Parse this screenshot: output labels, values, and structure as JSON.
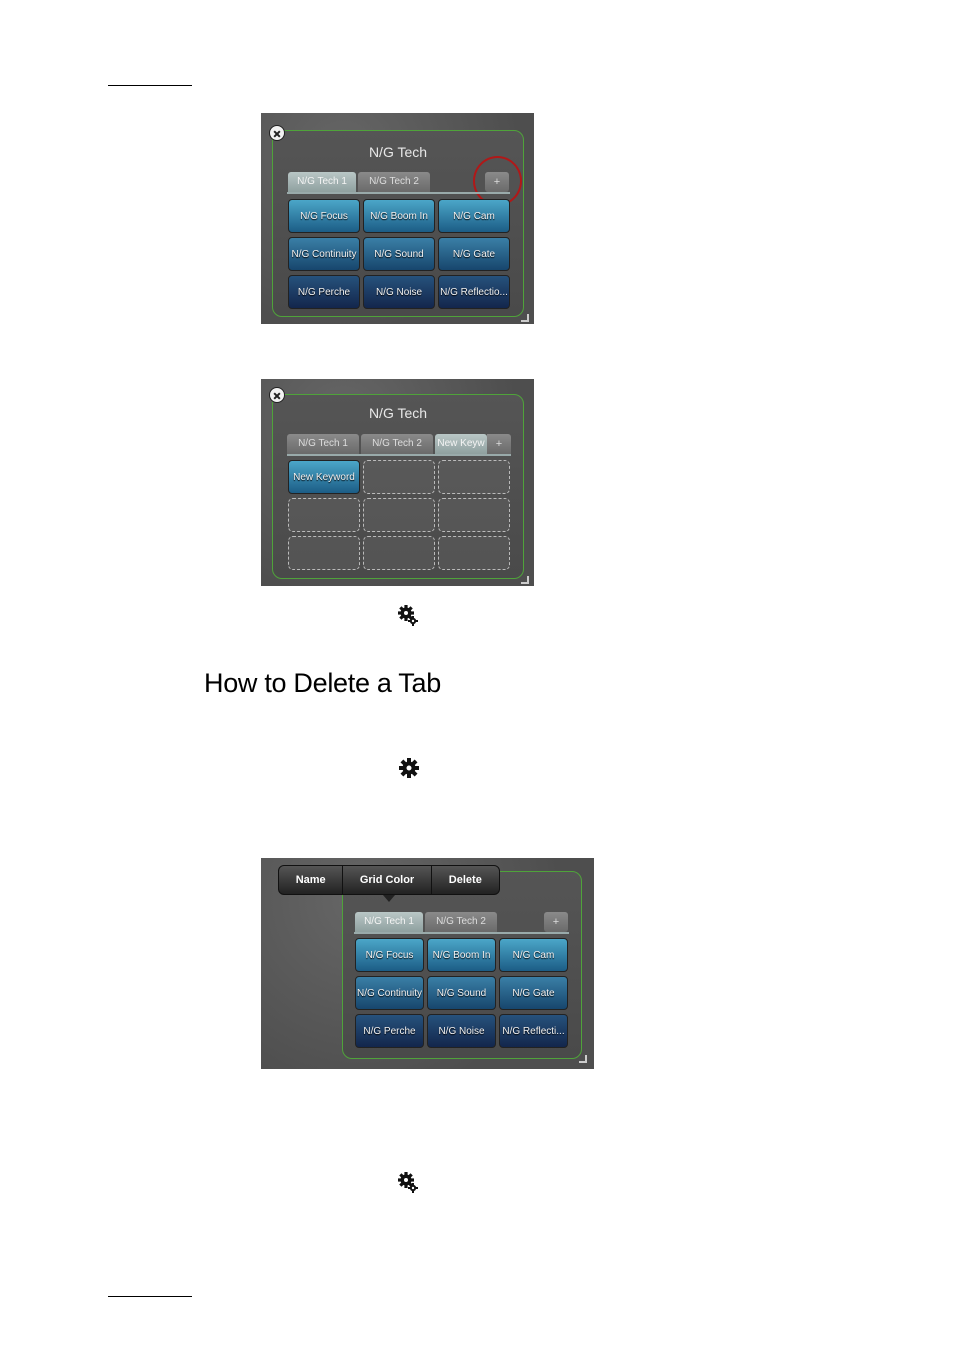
{
  "heading": "How to Delete a Tab",
  "shot1": {
    "title": "N/G Tech",
    "tabs": [
      "N/G Tech 1",
      "N/G Tech 2"
    ],
    "plus": "+",
    "keys": [
      "N/G Focus",
      "N/G Boom In",
      "N/G Cam",
      "N/G Continuity",
      "N/G Sound",
      "N/G Gate",
      "N/G Perche",
      "N/G Noise",
      "N/G Reflectio..."
    ]
  },
  "shot2": {
    "title": "N/G Tech",
    "tabs": [
      "N/G Tech 1",
      "N/G Tech 2",
      "New Keyw"
    ],
    "plus": "+",
    "keys": [
      "New Keyword"
    ]
  },
  "shot3": {
    "menu": [
      "Name",
      "Grid Color",
      "Delete"
    ],
    "tabs": [
      "N/G Tech 1",
      "N/G Tech 2"
    ],
    "plus": "+",
    "keys": [
      "N/G Focus",
      "N/G Boom In",
      "N/G Cam",
      "N/G Continuity",
      "N/G Sound",
      "N/G Gate",
      "N/G Perche",
      "N/G Noise",
      "N/G Reflecti..."
    ]
  },
  "icons": [
    "gears-icon",
    "gear-icon",
    "gears-icon"
  ]
}
